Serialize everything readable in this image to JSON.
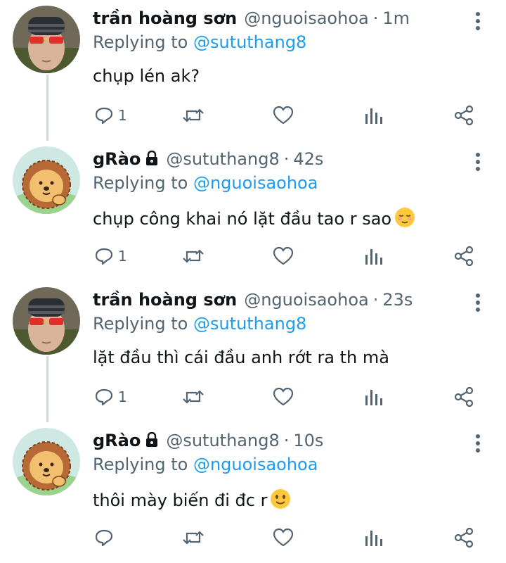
{
  "tweets": [
    {
      "name": "trần hoàng sơn",
      "handle": "@nguoisaohoa",
      "dot": "·",
      "time": "1m",
      "locked": false,
      "replying_prefix": "Replying to ",
      "replying_to": "@sututhang8",
      "text": "chụp lén ak?",
      "emoji": "",
      "reply_count": "1",
      "avatar": "person-red-glasses"
    },
    {
      "name": "gRào",
      "handle": "@sututhang8",
      "dot": "·",
      "time": "42s",
      "locked": true,
      "replying_prefix": "Replying to ",
      "replying_to": "@nguoisaohoa",
      "text": "chụp công khai nó lặt đầu tao r sao",
      "emoji": "relieved-face",
      "reply_count": "1",
      "avatar": "lion-cartoon"
    },
    {
      "name": "trần hoàng sơn",
      "handle": "@nguoisaohoa",
      "dot": "·",
      "time": "23s",
      "locked": false,
      "replying_prefix": "Replying to ",
      "replying_to": "@sututhang8",
      "text": "lặt đầu thì cái đầu anh rớt ra th mà",
      "emoji": "",
      "reply_count": "1",
      "avatar": "person-red-glasses"
    },
    {
      "name": "gRào",
      "handle": "@sututhang8",
      "dot": "·",
      "time": "10s",
      "locked": true,
      "replying_prefix": "Replying to ",
      "replying_to": "@nguoisaohoa",
      "text": "thôi mày biến đi đc r",
      "emoji": "slightly-smiling-face",
      "reply_count": "",
      "avatar": "lion-cartoon"
    }
  ],
  "colors": {
    "text": "#0f1419",
    "secondary": "#536471",
    "link": "#1d9bf0",
    "thread_line": "#cfd9de"
  }
}
